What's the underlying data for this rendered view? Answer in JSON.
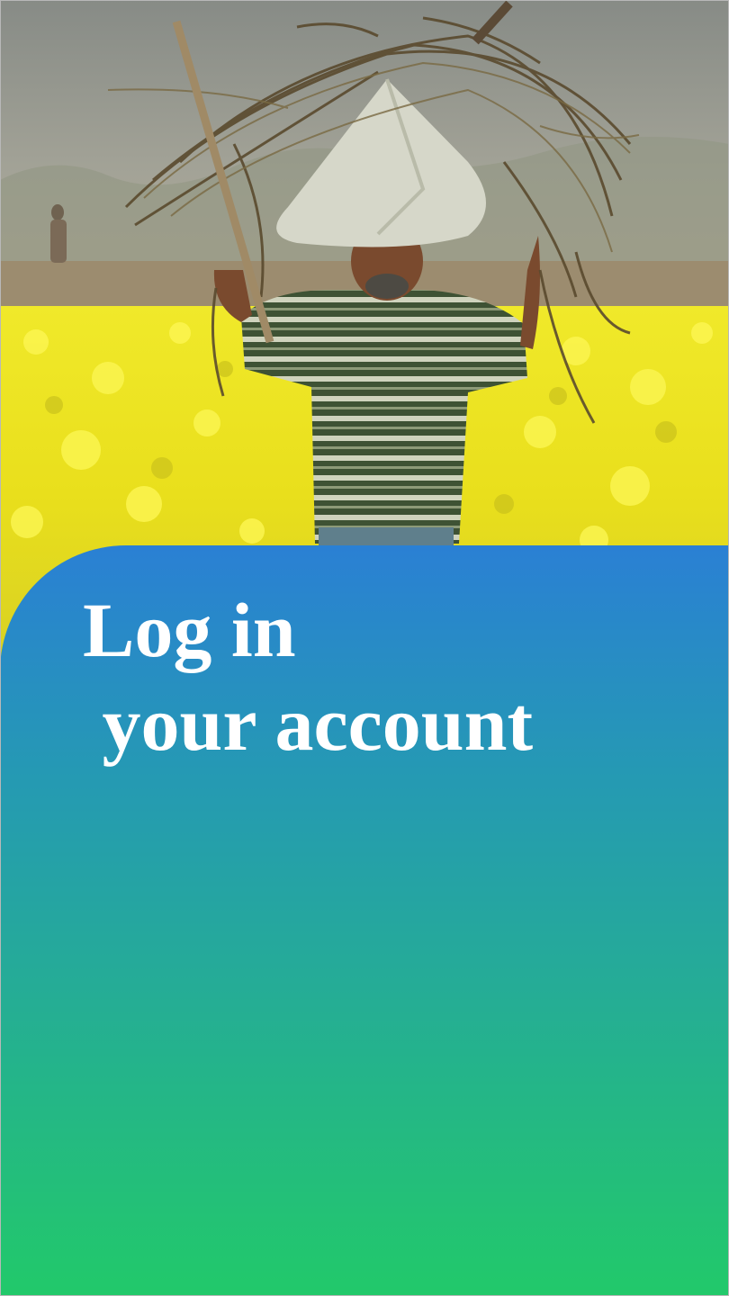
{
  "hero": {
    "image_name": "farmer-mustard-field-photo"
  },
  "login": {
    "title_line1": "Log in",
    "title_line2": " your account"
  },
  "colors": {
    "gradient_top": "#2a80d4",
    "gradient_mid": "#25ad95",
    "gradient_bottom": "#22c96a",
    "title_text": "#ffffff",
    "mustard_yellow": "#f2ea1c"
  }
}
